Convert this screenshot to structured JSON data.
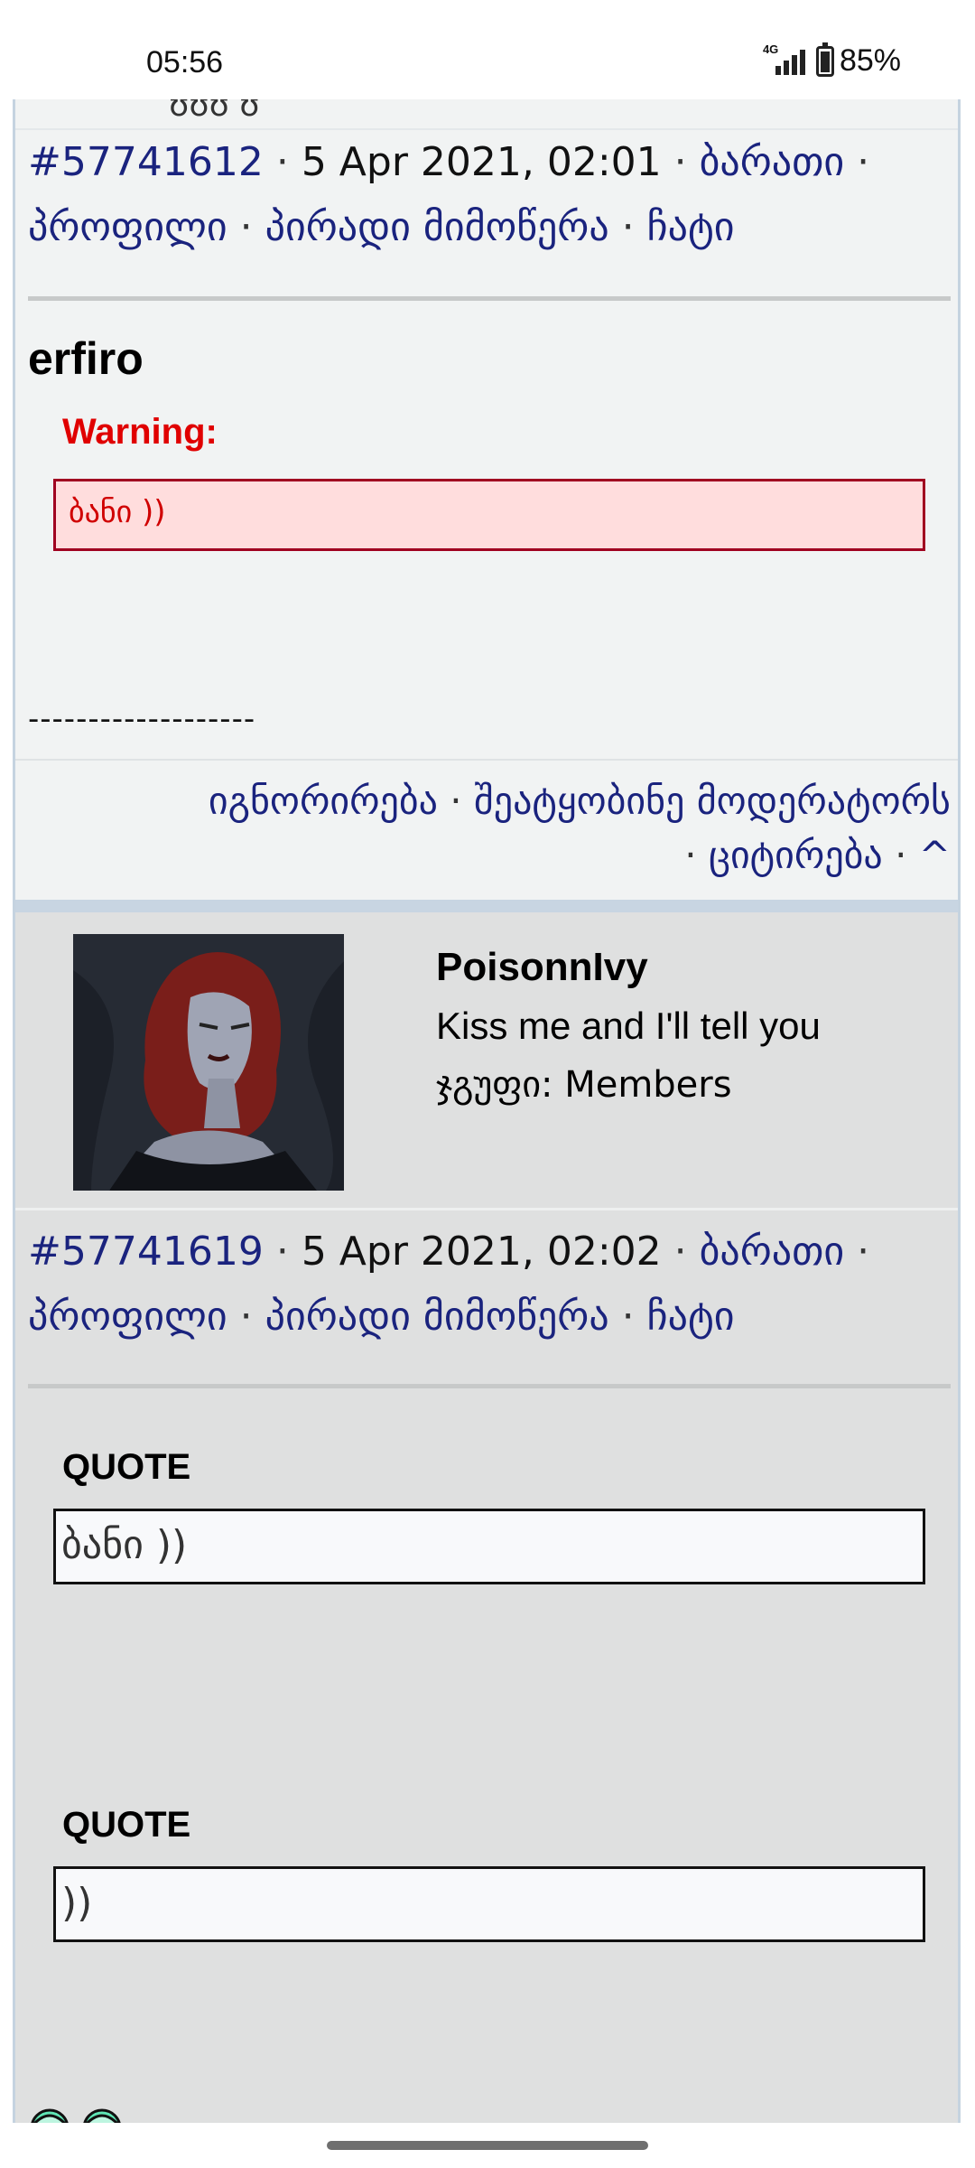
{
  "status_bar": {
    "time": "05:56",
    "network": "4G",
    "battery": "85%"
  },
  "post1": {
    "number": "#57741612",
    "date": "5 Apr 2021, 02:01",
    "link_card": "ბარათი",
    "link_profile": "პროფილი",
    "link_pm": "პირადი მიმოწერა",
    "link_chat": "ჩატი",
    "author": "erfiro",
    "warning_label": "Warning:",
    "warning_text": "ბანი ))",
    "signature_dashes": "-------------------",
    "action_ignore": "იგნორირება",
    "action_report": "შეატყობინე მოდერატორს",
    "action_quote": "ციტირება",
    "action_top": "^"
  },
  "post2": {
    "username": "PoisonnIvy",
    "user_title": "Kiss me and I'll tell you",
    "group": "ჯგუფი: Members",
    "avatar_icon": "avatar-image",
    "number": "#57741619",
    "date": "5 Apr 2021, 02:02",
    "link_card": "ბარათი",
    "link_profile": "პროფილი",
    "link_pm": "პირადი მიმოწერა",
    "link_chat": "ჩატი",
    "quote1_label": "QUOTE",
    "quote1_text": "ბანი ))",
    "quote2_label": "QUOTE",
    "quote2_text": "))",
    "smileys": [
      "smiley-icon",
      "smiley-icon"
    ]
  },
  "colors": {
    "link": "#1a237e",
    "warning": "#e00000",
    "warning_bg": "#ffdddd",
    "post_bg": "#dfe0e0"
  }
}
